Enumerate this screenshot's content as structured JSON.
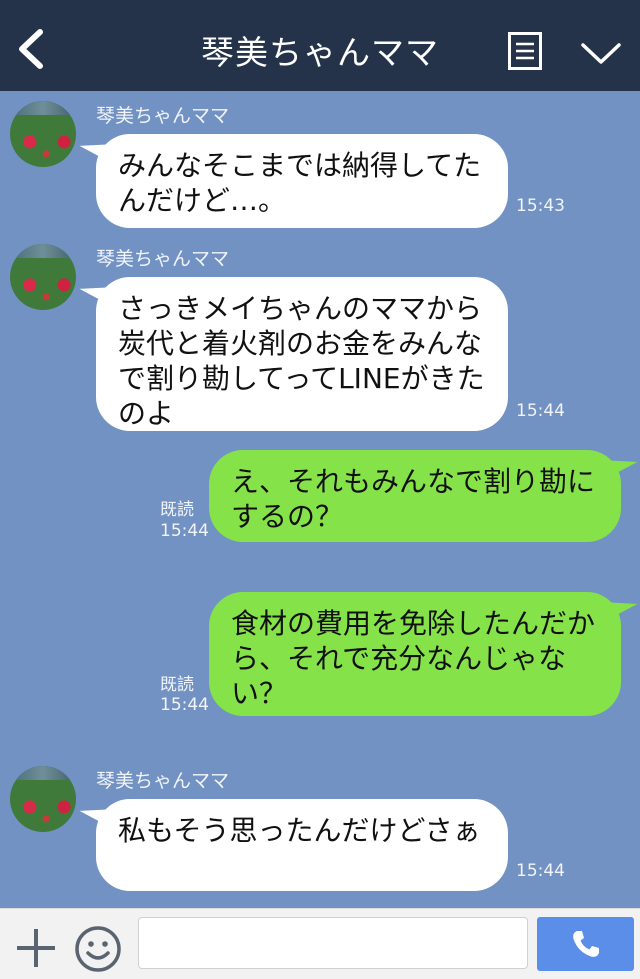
{
  "header": {
    "title": "琴美ちゃんママ",
    "icons": [
      "back-chevron-icon",
      "menu-icon",
      "chevron-down-icon"
    ]
  },
  "messages": [
    {
      "direction": "in",
      "sender": "琴美ちゃんママ",
      "text": "みんなそこまでは納得してたんだけど…。",
      "time": "15:43"
    },
    {
      "direction": "in",
      "sender": "琴美ちゃんママ",
      "text": "さっきメイちゃんのママから炭代と着火剤のお金をみんなで割り勘してってLINEがきたのよ",
      "time": "15:44"
    },
    {
      "direction": "out",
      "read": "既読",
      "text": "え、それもみんなで割り勘にするの？",
      "time": "15:44"
    },
    {
      "direction": "out",
      "read": "既読",
      "text": "食材の費用を免除したんだから、それで充分なんじゃない？",
      "time": "15:44"
    },
    {
      "direction": "in",
      "sender": "琴美ちゃんママ",
      "text": "私もそう思ったんだけどさぁ",
      "time": "15:44"
    }
  ],
  "footer": {
    "input_value": "",
    "icons": [
      "plus-icon",
      "emoji-icon",
      "phone-icon"
    ]
  },
  "colors": {
    "header_bg": "#243349",
    "chat_bg": "#7192c3",
    "incoming_bubble": "#ffffff",
    "outgoing_bubble": "#85e249",
    "call_button": "#5b8ee8"
  }
}
